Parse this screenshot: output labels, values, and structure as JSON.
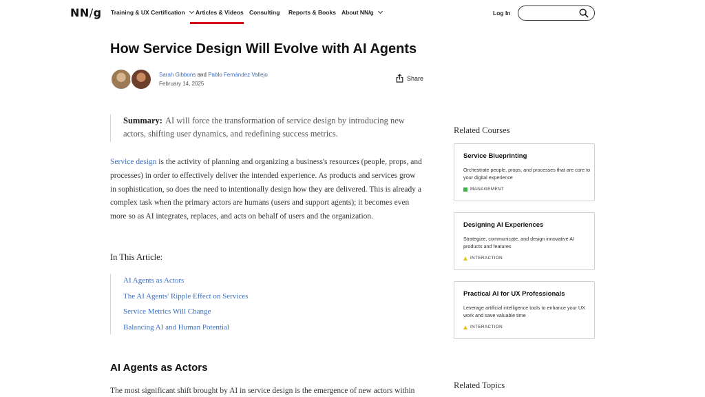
{
  "header": {
    "logo": "NN",
    "logo_slash": "/",
    "logo_g": "g",
    "nav": [
      {
        "label": "Training & UX Certification"
      },
      {
        "label": "Articles & Videos"
      },
      {
        "label": "Consulting"
      },
      {
        "label": "Reports & Books"
      },
      {
        "label": "About NN/g"
      }
    ],
    "login": "Log In",
    "search_placeholder": ""
  },
  "article": {
    "title": "How Service Design Will Evolve with AI Agents",
    "author1": "Sarah Gibbons",
    "and": "and",
    "author2": "Pablo Fernández Vallejo",
    "date": "February 14, 2025",
    "share": "Share",
    "summary_label": "Summary:",
    "summary_text": "AI will force the transformation of service design by introducing new actors, shifting user dynamics, and redefining success metrics.",
    "intro_link": "Service design",
    "intro_text": " is the activity of planning and organizing a business's resources (people, props, and processes) in order to effectively deliver the intended experience. As products and services grow in sophistication, so does the need to intentionally design how they are delivered. This is already a complex task when the primary actors are humans (users and support agents); it becomes even more so as AI integrates, replaces, and acts on behalf of users and the organization.",
    "toc_heading": "In This Article:",
    "toc": [
      "AI Agents as Actors",
      "The AI Agents' Ripple Effect on Services",
      "Service Metrics Will Change",
      "Balancing AI and Human Potential"
    ],
    "section_heading": "AI Agents as Actors",
    "section_text": "The most significant shift brought by AI in service design is the emergence of new actors within"
  },
  "sidebar": {
    "courses_heading": "Related Courses",
    "courses": [
      {
        "title": "Service Blueprinting",
        "desc": "Orchestrate people, props, and processes that are core to your digital experience",
        "tag": "MANAGEMENT",
        "tag_color": "#3cb44b"
      },
      {
        "title": "Designing AI Experiences",
        "desc": "Strategize, communicate, and design innovative AI products and features",
        "tag": "INTERACTION",
        "tag_color": "#e8c21a"
      },
      {
        "title": "Practical AI for UX Professionals",
        "desc": "Leverage artificial intelligence tools to enhance your UX work and save valuable time",
        "tag": "INTERACTION",
        "tag_color": "#e8c21a"
      }
    ],
    "topics_heading": "Related Topics"
  },
  "colors": {
    "accent_red": "#d0021b",
    "link_blue": "#3b6fc4"
  }
}
